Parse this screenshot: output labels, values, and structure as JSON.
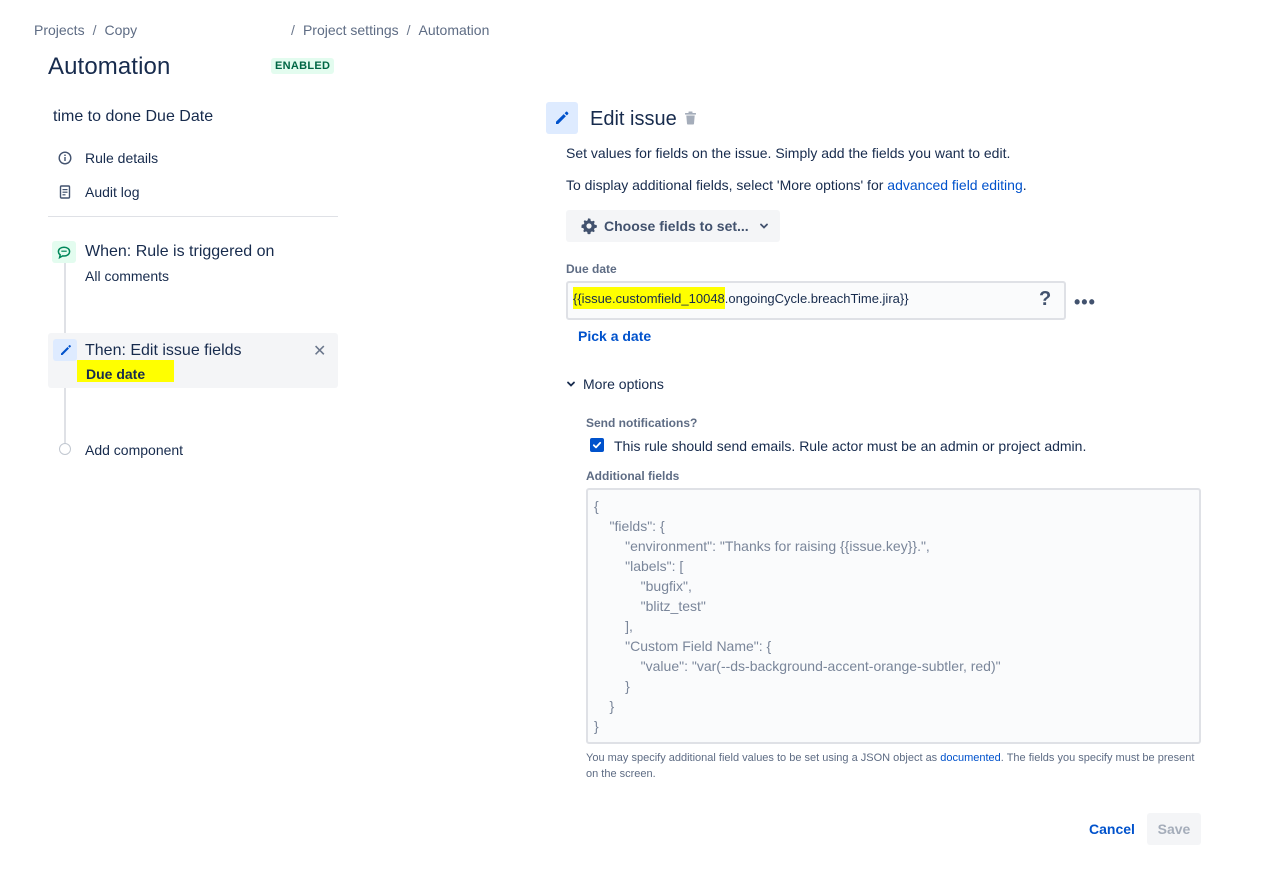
{
  "breadcrumb": {
    "items": [
      "Projects",
      "Copy",
      "Project settings",
      "Automation"
    ],
    "separator": "/"
  },
  "page": {
    "title": "Automation",
    "status_badge": "ENABLED"
  },
  "sidebar": {
    "rule_name": "time to done Due Date",
    "nav": [
      {
        "label": "Rule details",
        "icon": "info-icon"
      },
      {
        "label": "Audit log",
        "icon": "document-icon"
      }
    ],
    "trigger": {
      "title": "When: Rule is triggered on",
      "subtitle": "All comments",
      "icon": "comment-icon"
    },
    "action": {
      "title": "Then: Edit issue fields",
      "subtitle": "Due date",
      "icon": "pencil-icon"
    },
    "add_component": "Add component"
  },
  "editor": {
    "title": "Edit issue",
    "description": "Set values for fields on the issue. Simply add the fields you want to edit.",
    "more_info_prefix": "To display additional fields, select 'More options' for ",
    "more_info_link": "advanced field editing",
    "more_info_suffix": ".",
    "choose_fields_label": "Choose fields to set...",
    "due_date": {
      "label": "Due date",
      "value_highlighted": "{{issue.customfield_10048",
      "value_rest": ".ongoingCycle.breachTime.jira}}",
      "help_icon": "?",
      "more_icon": "•••",
      "pick_date": "Pick a date"
    },
    "more_options": {
      "label": "More options",
      "send_notifications_label": "Send notifications?",
      "send_notifications_checked": true,
      "send_notifications_text": "This rule should send emails. Rule actor must be an admin or project admin.",
      "additional_fields_label": "Additional fields",
      "additional_fields_placeholder": [
        "{",
        "    \"fields\": {",
        "        \"environment\": \"Thanks for raising {{issue.key}}.\",",
        "        \"labels\": [",
        "            \"bugfix\",",
        "            \"blitz_test\"",
        "        ],",
        "        \"Custom Field Name\": {",
        "            \"value\": \"var(--ds-background-accent-orange-subtler, red)\"",
        "        }",
        "    }",
        "}"
      ],
      "help_prefix": "You may specify additional field values to be set using a JSON object as ",
      "help_link": "documented",
      "help_suffix": ". The fields you specify must be present on the screen."
    },
    "cancel_label": "Cancel",
    "save_label": "Save"
  },
  "colors": {
    "link": "#0052cc",
    "highlight": "#ffff00",
    "badge_bg": "#e3fcef",
    "badge_text": "#006644"
  }
}
